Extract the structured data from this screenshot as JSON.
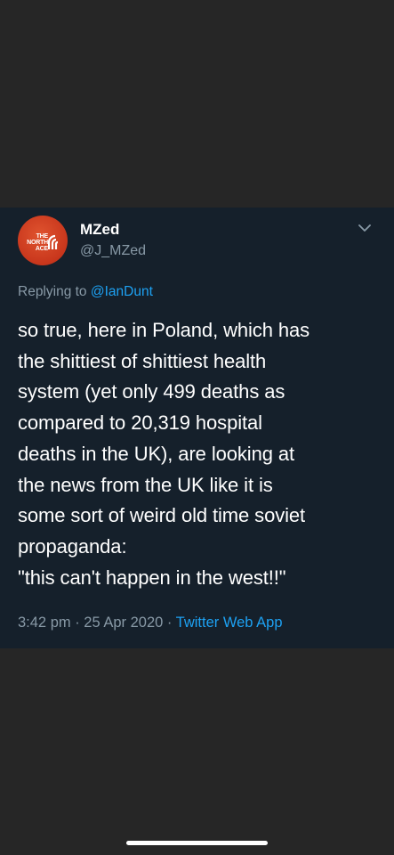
{
  "tweet": {
    "avatar_logo_text": "THE NORTH FACE",
    "display_name": "MZed",
    "handle": "@J_MZed",
    "replying_prefix": "Replying to ",
    "replying_mention": "@IanDunt",
    "text": "so true, here in Poland, which has\nthe shittiest of shittiest health\nsystem (yet only 499 deaths as\ncompared to 20,319 hospital\ndeaths in the UK), are looking at\nthe news from the UK like it is\nsome sort of weird old time soviet\npropaganda:\n\"this can't happen in the west!!\"",
    "time": "3:42 pm",
    "separator": " · ",
    "date": "25 Apr 2020",
    "source": "Twitter Web App"
  },
  "colors": {
    "page_background": "#262626",
    "card_background": "#15202b",
    "secondary_text": "#8899a6",
    "link": "#1da1f2",
    "avatar": "#c8361c"
  },
  "icons": {
    "menu": "chevron-down-icon",
    "avatar_logo": "north-face-logo-icon"
  }
}
